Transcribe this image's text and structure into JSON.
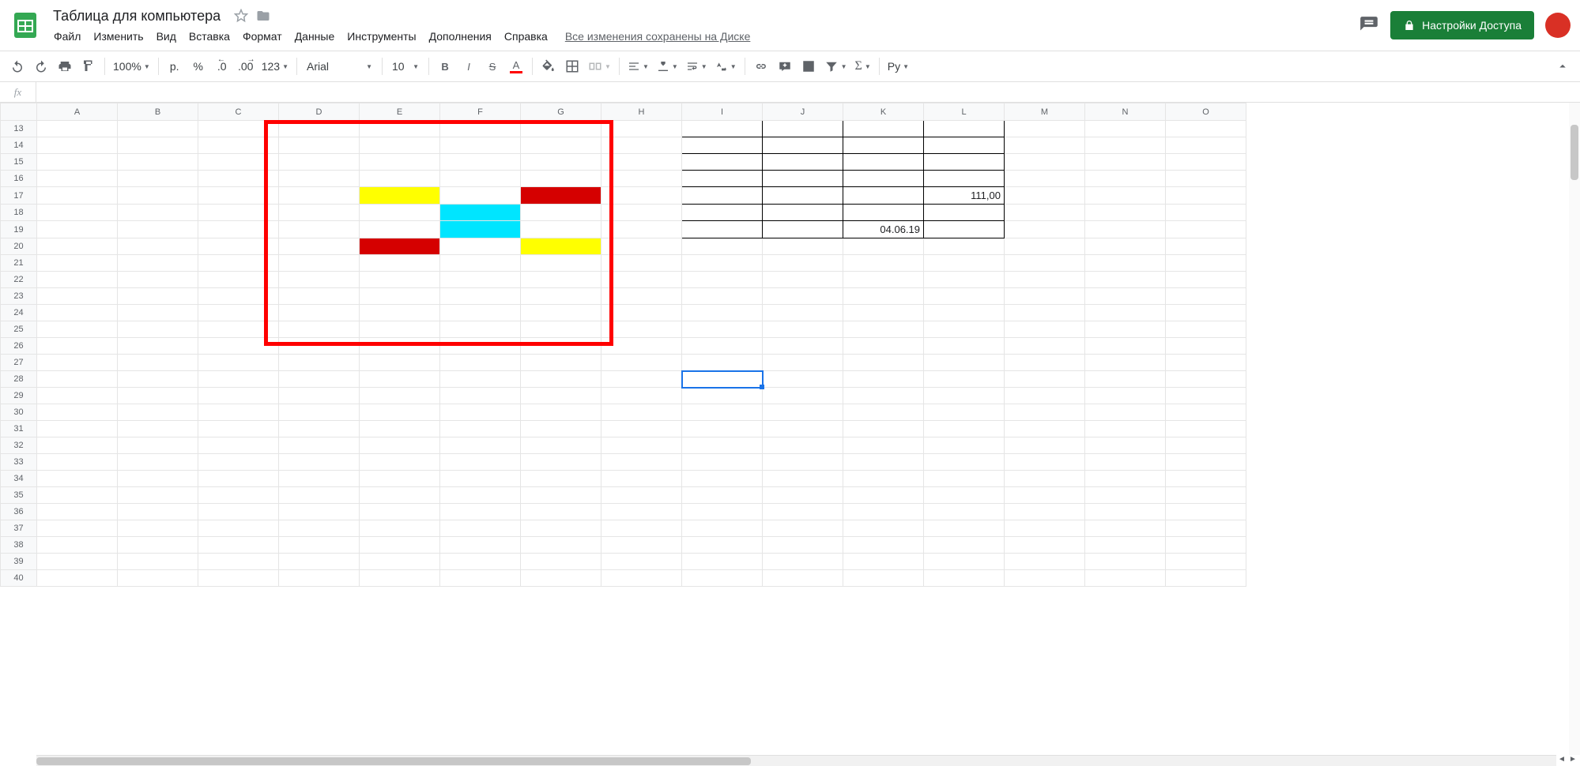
{
  "doc_title": "Таблица для компьютера",
  "menus": [
    "Файл",
    "Изменить",
    "Вид",
    "Вставка",
    "Формат",
    "Данные",
    "Инструменты",
    "Дополнения",
    "Справка"
  ],
  "save_status": "Все изменения сохранены на Диске",
  "share_label": "Настройки Доступа",
  "toolbar": {
    "zoom": "100%",
    "currency_label": "р.",
    "percent_label": "%",
    "dec_dec": ".0",
    "inc_dec": ".00",
    "more_formats": "123",
    "font_name": "Arial",
    "font_size": "10",
    "script_label": "Ру"
  },
  "formula_bar": {
    "fx": "fx",
    "value": ""
  },
  "columns": [
    "A",
    "B",
    "C",
    "D",
    "E",
    "F",
    "G",
    "H",
    "I",
    "J",
    "K",
    "L",
    "M",
    "N",
    "O"
  ],
  "first_row": 13,
  "last_row": 40,
  "col_width_default": 102,
  "selected_cell": {
    "row": 28,
    "col": "I"
  },
  "cell_values": {
    "L17": "111,00",
    "K19": "04.06.19"
  },
  "annotation_border_color": "#ff0000",
  "bordered_table": {
    "top_row": 13,
    "bottom_row": 19,
    "left_col": "I",
    "right_col": "L"
  },
  "colored_cells": [
    {
      "row": 17,
      "col": "E",
      "color": "#ffff00"
    },
    {
      "row": 17,
      "col": "G",
      "color": "#d50000"
    },
    {
      "row": 18,
      "col": "F",
      "color": "#00e5ff"
    },
    {
      "row": 19,
      "col": "F",
      "color": "#00e5ff"
    },
    {
      "row": 20,
      "col": "E",
      "color": "#d50000"
    },
    {
      "row": 20,
      "col": "G",
      "color": "#ffff00"
    }
  ],
  "annotation_box": {
    "top_row": 13,
    "bottom_row": 25,
    "left_col": "D",
    "right_col": "H"
  }
}
